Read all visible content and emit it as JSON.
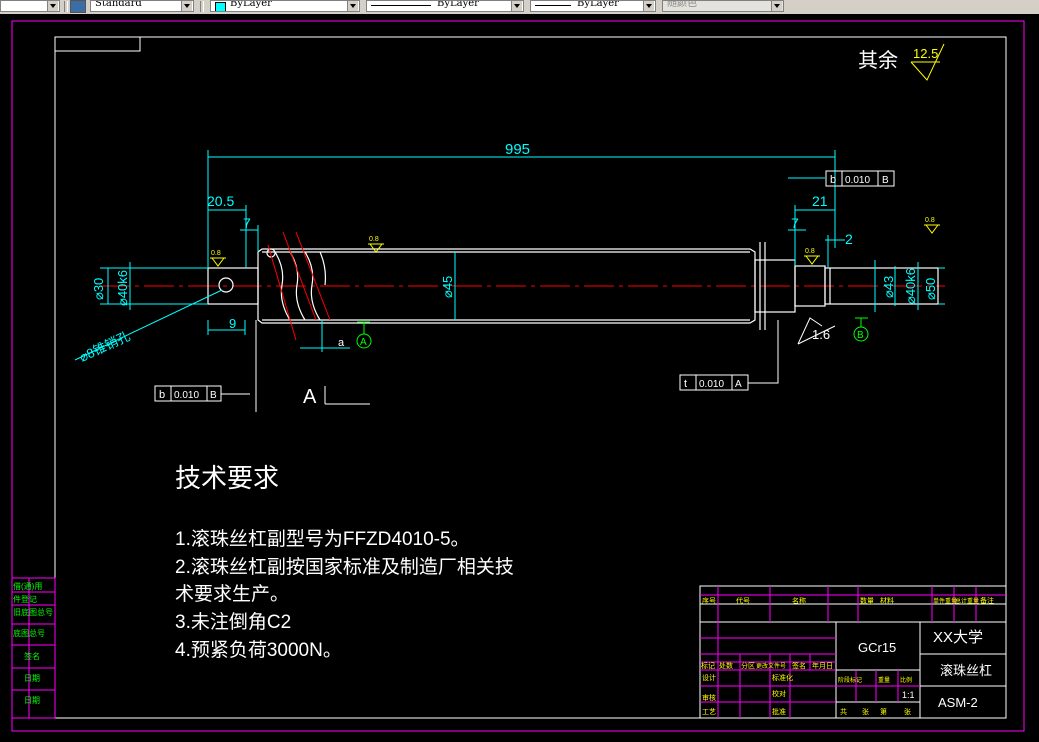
{
  "toolbar": {
    "textstyle": "Standard",
    "layer": "ByLayer",
    "linetype": "ByLayer",
    "lineweight": "ByLayer",
    "plotstyle": "随颜色"
  },
  "drawing": {
    "roughness_rest": "其余",
    "roughness_rest_value": "12.5",
    "dim_total": "995",
    "dim_20_5": "20.5",
    "dim_7_left": "7",
    "dim_7_right": "7",
    "dim_21": "21",
    "dim_2": "2",
    "dim_9": "9",
    "dim_phi30": "⌀30",
    "dim_phi40k6_left": "⌀40k6",
    "dim_phi45": "⌀45",
    "dim_phi40k6_right": "⌀40k6",
    "dim_phi50": "⌀50",
    "dim_phi43": "⌀43",
    "pin_hole": "⌀8锥销孔",
    "rough_small": "0.8",
    "rough_1_6": "1.6",
    "rough_a": "a",
    "datum_a": "A",
    "datum_b": "B",
    "section_a": "A",
    "tol_left_sym": "b",
    "tol_left_val": "0.010",
    "tol_left_datum": "B",
    "tol_top_sym": "b",
    "tol_top_val": "0.010",
    "tol_top_datum": "B",
    "tol_right_sym": "t",
    "tol_right_val": "0.010",
    "tol_right_datum": "A"
  },
  "notes": {
    "title": "技术要求",
    "lines": [
      "1.滚珠丝杠副型号为FFZD4010-5。",
      "2.滚珠丝杠副按国家标准及制造厂相关技",
      "术要求生产。",
      "3.未注倒角C2",
      "4.预紧负荷3000N。"
    ]
  },
  "side_labels": [
    "借(通)用",
    "件登记",
    "旧底图总号",
    "底图总号",
    "签名",
    "日期",
    "日期"
  ],
  "title_block": {
    "header": [
      "序号",
      "代号",
      "名称",
      "数量",
      "材料",
      "单件重量",
      "总计重量",
      "备注"
    ],
    "material": "GCr15",
    "school": "XX大学",
    "part_name": "滚珠丝杠",
    "drawing_no": "ASM-2",
    "scale": "1:1",
    "row_labels": [
      "标记",
      "处数",
      "分区",
      "更改文件号",
      "签名",
      "年月日"
    ],
    "design_labels": [
      "设计",
      "标准化",
      "审核",
      "工艺",
      "校对",
      "批准"
    ],
    "stage_labels": [
      "阶段标记",
      "重量",
      "比例"
    ],
    "sheet_labels": [
      "共",
      "张",
      "第",
      "张"
    ]
  },
  "colors": {
    "background": "#000000",
    "border": "#ff00ff",
    "frame": "#ffffff",
    "dimension": "#00ffff",
    "centerline": "#ff0000",
    "roughness": "#ffff00",
    "datum": "#00ff00"
  }
}
